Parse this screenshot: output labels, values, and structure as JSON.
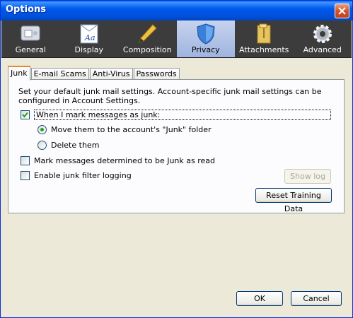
{
  "window": {
    "title": "Options"
  },
  "panes": [
    {
      "label": "General",
      "icon": "general-icon"
    },
    {
      "label": "Display",
      "icon": "display-icon"
    },
    {
      "label": "Composition",
      "icon": "pen-icon"
    },
    {
      "label": "Privacy",
      "icon": "shield-icon",
      "selected": true
    },
    {
      "label": "Attachments",
      "icon": "folder-icon"
    },
    {
      "label": "Advanced",
      "icon": "gear-icon"
    }
  ],
  "tabs": [
    {
      "label": "Junk",
      "selected": true
    },
    {
      "label": "E-mail Scams"
    },
    {
      "label": "Anti-Virus"
    },
    {
      "label": "Passwords"
    }
  ],
  "junk": {
    "description": "Set your default junk mail settings. Account-specific junk mail settings can be configured in Account Settings.",
    "mark_as_junk_label": "When I mark messages as junk:",
    "mark_as_junk_checked": true,
    "move_label": "Move them to the account's \"Junk\" folder",
    "move_selected": true,
    "delete_label": "Delete them",
    "delete_selected": false,
    "mark_read_label": "Mark messages determined to be Junk as read",
    "mark_read_checked": false,
    "logging_label": "Enable junk filter logging",
    "logging_checked": false,
    "show_log_label": "Show log",
    "reset_label": "Reset Training Data"
  },
  "footer": {
    "ok_label": "OK",
    "cancel_label": "Cancel"
  },
  "colors": {
    "titlebar": "#0058ee",
    "toolbar": "#3c3c3c",
    "selected_pane": "#b3c4e8",
    "dialog": "#ece9d8"
  }
}
